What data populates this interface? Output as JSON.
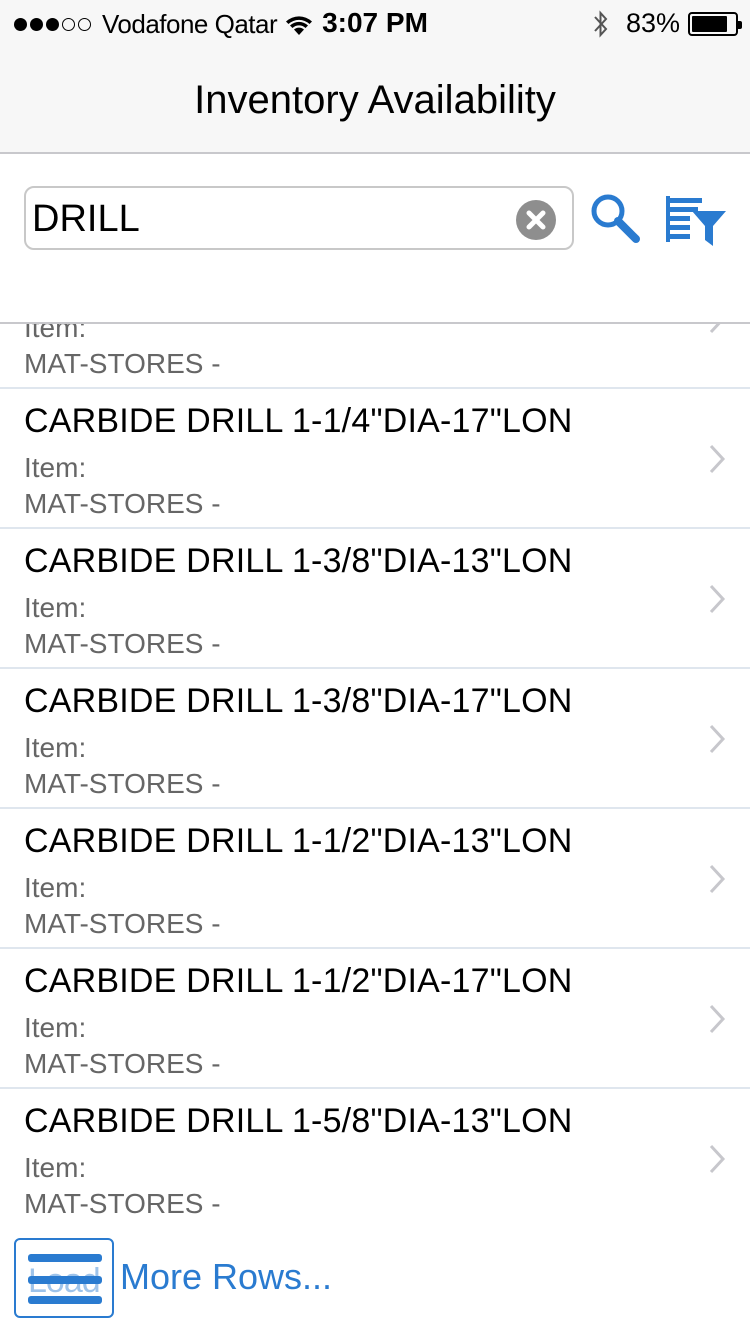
{
  "status_bar": {
    "carrier": "Vodafone Qatar",
    "time": "3:07 PM",
    "battery_percent": "83%",
    "battery_level": 0.83,
    "signal_bars_filled": 3,
    "signal_bars_total": 5
  },
  "nav": {
    "title": "Inventory Availability"
  },
  "search": {
    "value": "DRILL"
  },
  "list": {
    "partial_row": {
      "item_label": "Item:",
      "store": "MAT-STORES -"
    },
    "rows": [
      {
        "name": "CARBIDE DRILL 1-1/4\"DIA-17\"LON",
        "item_label": "Item:",
        "store": "MAT-STORES -"
      },
      {
        "name": "CARBIDE DRILL 1-3/8\"DIA-13\"LON",
        "item_label": "Item:",
        "store": "MAT-STORES -"
      },
      {
        "name": "CARBIDE DRILL 1-3/8\"DIA-17\"LON",
        "item_label": "Item:",
        "store": "MAT-STORES -"
      },
      {
        "name": "CARBIDE DRILL 1-1/2\"DIA-13\"LON",
        "item_label": "Item:",
        "store": "MAT-STORES -"
      },
      {
        "name": "CARBIDE DRILL 1-1/2\"DIA-17\"LON",
        "item_label": "Item:",
        "store": "MAT-STORES -"
      },
      {
        "name": "CARBIDE DRILL 1-5/8\"DIA-13\"LON",
        "item_label": "Item:",
        "store": "MAT-STORES -"
      }
    ]
  },
  "load_more": {
    "button_label": "Load",
    "link_text": "More Rows..."
  },
  "colors": {
    "accent": "#2a7bd0",
    "secondary_text": "#666666",
    "divider": "#dfe6ee"
  }
}
